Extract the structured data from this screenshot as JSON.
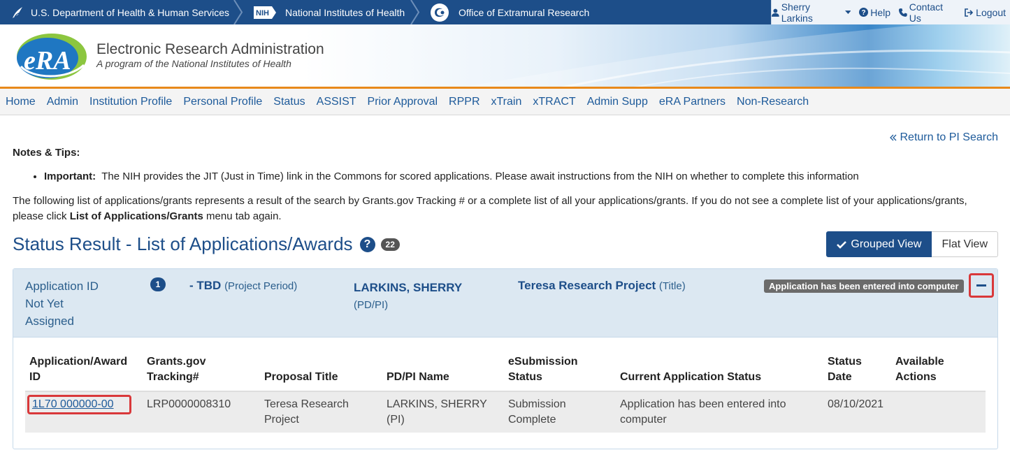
{
  "topbar": {
    "hhs": "U.S. Department of Health & Human Services",
    "nih_logo": "NIH",
    "nih": "National Institutes of Health",
    "oer": "Office of Extramural Research",
    "user": "Sherry Larkins",
    "help": "Help",
    "contact": "Contact Us",
    "logout": "Logout"
  },
  "banner": {
    "logo_text": "eRA",
    "title": "Electronic Research Administration",
    "subtitle": "A program of the National Institutes of Health"
  },
  "nav": {
    "items": [
      "Home",
      "Admin",
      "Institution Profile",
      "Personal Profile",
      "Status",
      "ASSIST",
      "Prior Approval",
      "RPPR",
      "xTrain",
      "xTRACT",
      "Admin Supp",
      "eRA Partners",
      "Non-Research"
    ]
  },
  "return_link": "Return to PI Search",
  "notes": {
    "heading": "Notes & Tips:",
    "important_label": "Important:",
    "important_text": "The NIH provides the JIT (Just in Time) link in the Commons for scored applications. Please await instructions from the NIH on whether to complete this information"
  },
  "intro": {
    "text1": "The following list of applications/grants represents a result of the search by Grants.gov Tracking # or a complete list of all your applications/grants. If you do not see a complete list of your applications/grants, please click ",
    "bold": "List of Applications/Grants",
    "text2": " menu tab again."
  },
  "page": {
    "title": "Status Result - List of Applications/Awards",
    "help": "?",
    "count": "22"
  },
  "views": {
    "grouped": "Grouped View",
    "flat": "Flat View"
  },
  "group": {
    "app_id": "Application ID Not Yet Assigned",
    "badge": "1",
    "period": "- TBD",
    "period_suffix": "(Project Period)",
    "pi": "LARKINS, SHERRY",
    "pi_suffix": "(PD/PI)",
    "title": "Teresa Research Project",
    "title_suffix": "(Title)",
    "status": "Application has been entered into computer"
  },
  "table": {
    "headers": [
      "Application/Award ID",
      "Grants.gov Tracking#",
      "Proposal Title",
      "PD/PI Name",
      "eSubmission Status",
      "Current Application Status",
      "Status Date",
      "Available Actions"
    ],
    "rows": [
      {
        "app_id": "1L70 000000-00",
        "tracking": "LRP0000008310",
        "title": "Teresa Research Project",
        "pi": "LARKINS, SHERRY (PI)",
        "esub": "Submission Complete",
        "status": "Application has been entered into computer",
        "date": "08/10/2021",
        "actions": ""
      }
    ]
  },
  "colors": {
    "brand_blue": "#1d4e89",
    "link_blue": "#1d5a9a",
    "highlight_red": "#d9383a",
    "banner_orange": "#e8891b"
  }
}
